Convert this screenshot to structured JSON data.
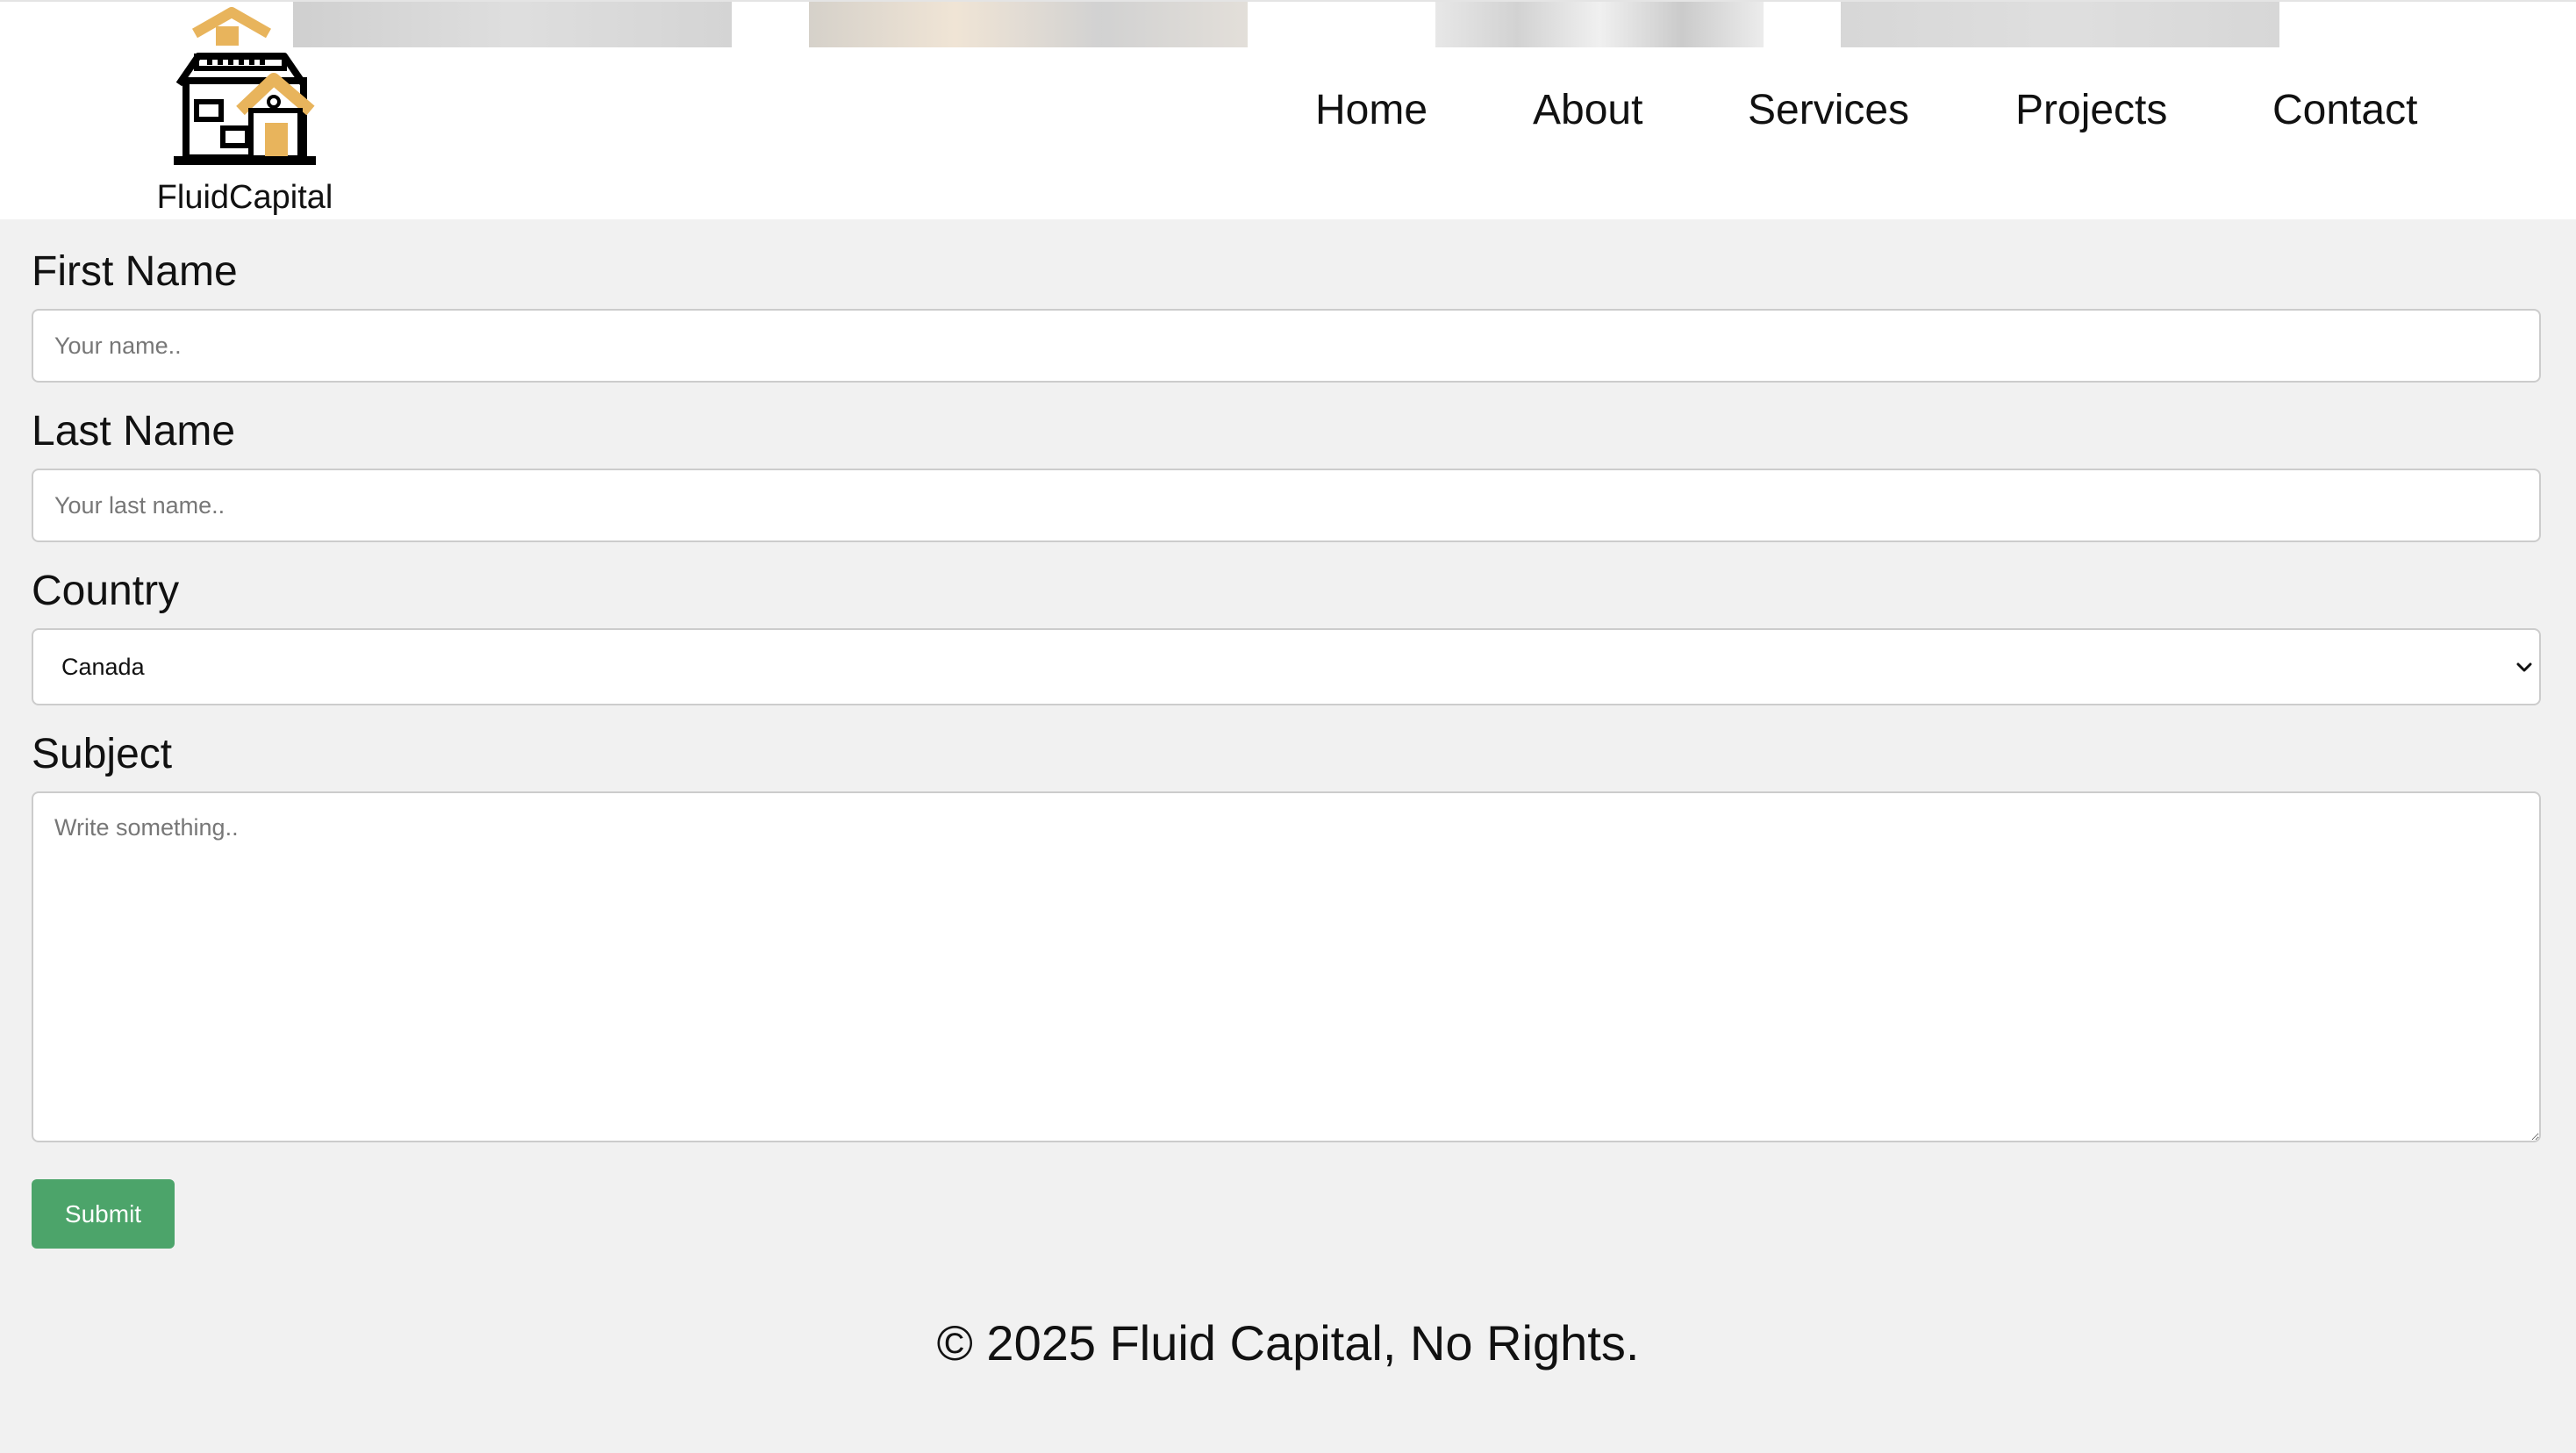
{
  "brand": {
    "name": "FluidCapital",
    "accent": "#e8b45c"
  },
  "nav": {
    "items": [
      {
        "label": "Home"
      },
      {
        "label": "About"
      },
      {
        "label": "Services"
      },
      {
        "label": "Projects"
      },
      {
        "label": "Contact"
      }
    ]
  },
  "form": {
    "first_name": {
      "label": "First Name",
      "placeholder": "Your name.."
    },
    "last_name": {
      "label": "Last Name",
      "placeholder": "Your last name.."
    },
    "country": {
      "label": "Country",
      "selected": "Canada"
    },
    "subject": {
      "label": "Subject",
      "placeholder": "Write something.."
    },
    "submit_label": "Submit",
    "submit_color": "#4ca46a"
  },
  "footer": {
    "text": "© 2025 Fluid Capital, No Rights."
  }
}
